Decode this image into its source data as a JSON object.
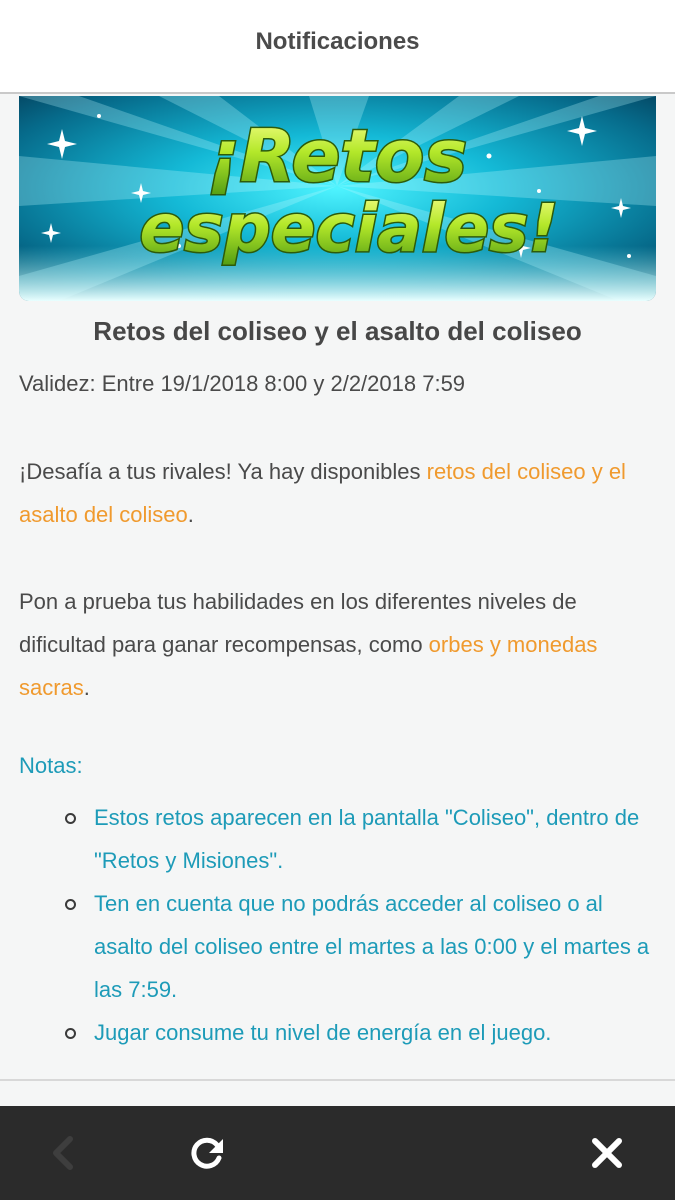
{
  "header": {
    "title": "Notificaciones"
  },
  "banner": {
    "line1": "¡Retos",
    "line2": "especiales!"
  },
  "article": {
    "title": "Retos del coliseo y el asalto del coliseo",
    "validity": "Validez: Entre 19/1/2018 8:00 y 2/2/2018 7:59",
    "p1": {
      "text1": "¡Desafía a tus rivales! Ya hay disponibles ",
      "link1": "retos del coliseo y el asalto del coliseo",
      "text2": "."
    },
    "p2": {
      "text1": "Pon a prueba tus habilidades en los diferentes niveles de dificultad para ganar recompensas, como ",
      "link1": "orbes y monedas sacras",
      "text2": "."
    },
    "notes_title": "Notas:",
    "notes": [
      "Estos retos aparecen en la pantalla \"Coliseo\", dentro de \"Retos y Misiones\".",
      "Ten en cuenta que no podrás acceder al coliseo o al asalto del coliseo entre el martes a las 0:00 y el martes a las 7:59.",
      "Jugar consume tu nivel de energía en el juego."
    ]
  },
  "bottom_nav": {
    "back_icon": "chevron-left-icon",
    "reload_icon": "reload-icon",
    "close_icon": "close-icon"
  },
  "colors": {
    "accent_orange": "#f09a2e",
    "notes_teal": "#1d9bb8",
    "bottom_bar": "#2b2b2b",
    "banner_cyan": "#2fd6ec",
    "banner_text_green": "#9ad81f"
  }
}
